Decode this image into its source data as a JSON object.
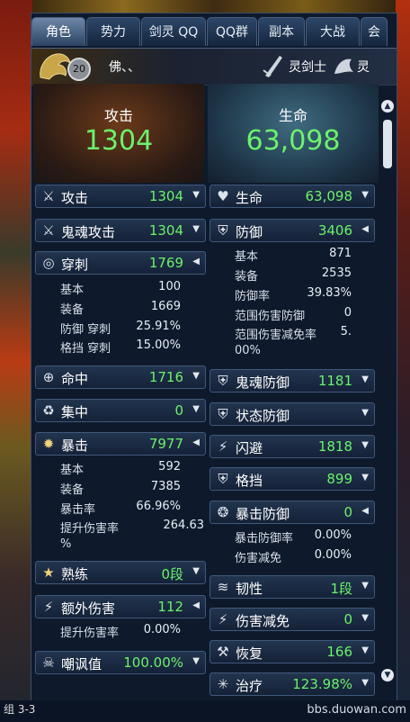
{
  "tabs": [
    "角色",
    "势力",
    "剑灵 QQ",
    "QQ群",
    "副本",
    "大战",
    "会"
  ],
  "character": {
    "level": "20",
    "name": "佛、、",
    "class": "灵剑士",
    "race": "灵"
  },
  "summary": {
    "attack_label": "攻击",
    "attack_value": "1304",
    "hp_label": "生命",
    "hp_value": "63,098"
  },
  "left": {
    "attack": {
      "label": "攻击",
      "value": "1304"
    },
    "ghost_attack": {
      "label": "鬼魂攻击",
      "value": "1304"
    },
    "pierce": {
      "label": "穿刺",
      "value": "1769",
      "base_label": "基本",
      "base": "100",
      "equip_label": "装备",
      "equip": "1669",
      "def_pierce_label": "防御 穿刺",
      "def_pierce": "25.91%",
      "block_pierce_label": "格挡 穿刺",
      "block_pierce": "15.00%"
    },
    "hit": {
      "label": "命中",
      "value": "1716"
    },
    "focus": {
      "label": "集中",
      "value": "0"
    },
    "crit": {
      "label": "暴击",
      "value": "7977",
      "base_label": "基本",
      "base": "592",
      "equip_label": "装备",
      "equip": "7385",
      "rate_label": "暴击率",
      "rate": "66.96%",
      "dmg_label": "提升伤害率",
      "dmg": "264.63",
      "dmg_pct": "%"
    },
    "mastery": {
      "label": "熟练",
      "value": "0段"
    },
    "extra_dmg": {
      "label": "额外伤害",
      "value": "112",
      "sub_label": "提升伤害率",
      "sub": "0.00%"
    },
    "taunt": {
      "label": "嘲讽值",
      "value": "100.00%"
    }
  },
  "right": {
    "hp": {
      "label": "生命",
      "value": "63,098"
    },
    "defense": {
      "label": "防御",
      "value": "3406",
      "base_label": "基本",
      "base": "871",
      "equip_label": "装备",
      "equip": "2535",
      "rate_label": "防御率",
      "rate": "39.83%",
      "range_label": "范围伤害防御",
      "range": "0",
      "range_red_label": "范围伤害减免率",
      "range_red": "5.",
      "range_red_cont": "00%"
    },
    "ghost_def": {
      "label": "鬼魂防御",
      "value": "1181"
    },
    "status_def": {
      "label": "状态防御"
    },
    "evade": {
      "label": "闪避",
      "value": "1818"
    },
    "block": {
      "label": "格挡",
      "value": "899"
    },
    "crit_def": {
      "label": "暴击防御",
      "value": "0",
      "rate_label": "暴击防御率",
      "rate": "0.00%",
      "red_label": "伤害减免",
      "red": "0.00%"
    },
    "tenacity": {
      "label": "韧性",
      "value": "1段"
    },
    "dmg_red": {
      "label": "伤害减免",
      "value": "0"
    },
    "recover": {
      "label": "恢复",
      "value": "166"
    },
    "heal": {
      "label": "治疗",
      "value": "123.98%"
    }
  },
  "footer": {
    "url": "bbs.duowan.com",
    "left": "组 3-3"
  },
  "colors": {
    "value_green": "#6bf26b",
    "panel_bg": "#0e1a2c",
    "row_border": "#41587a"
  }
}
